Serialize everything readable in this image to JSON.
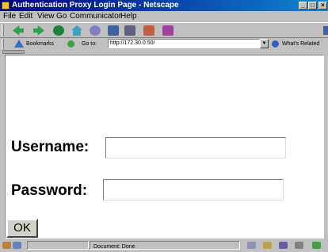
{
  "window": {
    "title": "Authentication Proxy Login Page - Netscape",
    "controls": {
      "minimize": "_",
      "maximize": "□",
      "close": "×"
    }
  },
  "menu": {
    "items": [
      "File",
      "Edit",
      "View",
      "Go",
      "Communicator",
      "Help"
    ]
  },
  "toolbar": {
    "icons": [
      "back-icon",
      "forward-icon",
      "reload-icon",
      "home-icon",
      "search-icon",
      "netscape-guide-icon",
      "print-icon",
      "security-icon",
      "stop-icon"
    ]
  },
  "location": {
    "bookmarks_label": "Bookmarks",
    "goto_label": "Go to:",
    "url": "http://172.30.0.50/",
    "whats_related": "What's Related"
  },
  "form": {
    "username_label": "Username:",
    "password_label": "Password:",
    "username_value": "",
    "password_value": "",
    "submit_label": "OK"
  },
  "status": {
    "text": "Document: Done"
  },
  "colors": {
    "titlebar": "#000080",
    "chrome": "#c0c0c0",
    "content": "#ffffff"
  }
}
